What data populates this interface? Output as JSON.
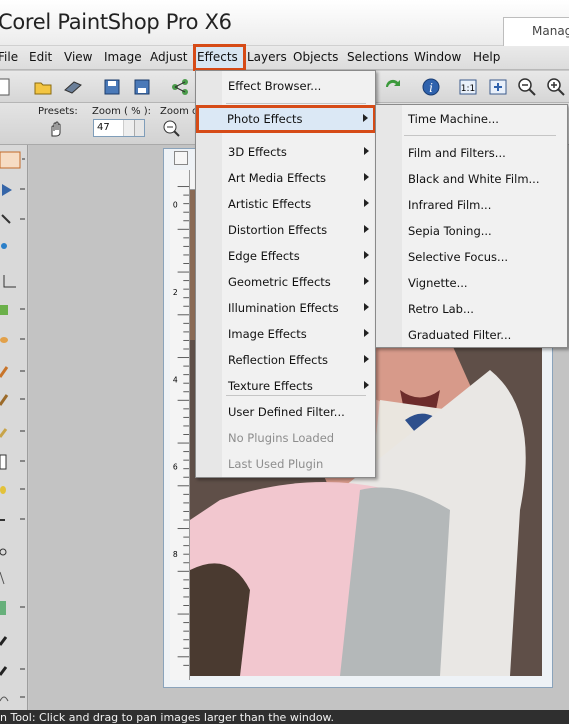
{
  "app": {
    "title": "Corel PaintShop Pro X6",
    "right_tab": "Manag"
  },
  "menubar": {
    "items": [
      "File",
      "Edit",
      "View",
      "Image",
      "Adjust",
      "Effects",
      "Layers",
      "Objects",
      "Selections",
      "Window",
      "Help"
    ]
  },
  "toolbar": {
    "presets_label": "Presets:",
    "zoom_label": "Zoom ( % ):",
    "zoom_value": "47",
    "zoom_out_label": "Zoom o"
  },
  "effects_menu": {
    "items": [
      {
        "label": "Effect Browser...",
        "submenu": false,
        "enabled": true
      },
      {
        "label": "Photo Effects",
        "submenu": true,
        "enabled": true,
        "highlighted": true
      },
      {
        "label": "3D Effects",
        "submenu": true,
        "enabled": true
      },
      {
        "label": "Art Media Effects",
        "submenu": true,
        "enabled": true
      },
      {
        "label": "Artistic Effects",
        "submenu": true,
        "enabled": true
      },
      {
        "label": "Distortion Effects",
        "submenu": true,
        "enabled": true
      },
      {
        "label": "Edge Effects",
        "submenu": true,
        "enabled": true
      },
      {
        "label": "Geometric Effects",
        "submenu": true,
        "enabled": true
      },
      {
        "label": "Illumination Effects",
        "submenu": true,
        "enabled": true
      },
      {
        "label": "Image Effects",
        "submenu": true,
        "enabled": true
      },
      {
        "label": "Reflection Effects",
        "submenu": true,
        "enabled": true
      },
      {
        "label": "Texture Effects",
        "submenu": true,
        "enabled": true
      },
      {
        "label": "User Defined Filter...",
        "submenu": false,
        "enabled": true
      },
      {
        "label": "No Plugins Loaded",
        "submenu": false,
        "enabled": false
      },
      {
        "label": "Last Used Plugin",
        "submenu": false,
        "enabled": false
      }
    ]
  },
  "photo_effects_submenu": {
    "items": [
      "Time Machine...",
      "Film and Filters...",
      "Black and White Film...",
      "Infrared Film...",
      "Sepia Toning...",
      "Selective Focus...",
      "Vignette...",
      "Retro Lab...",
      "Graduated Filter..."
    ]
  },
  "status": {
    "text": "n Tool: Click and drag to pan images larger than the window."
  },
  "ruler_ticks": [
    "0",
    "2",
    "4",
    "6",
    "8"
  ],
  "colors": {
    "highlight_border": "#d64b17",
    "menu_bg": "#f1f1f1",
    "status_bg": "#2f2f2f"
  }
}
